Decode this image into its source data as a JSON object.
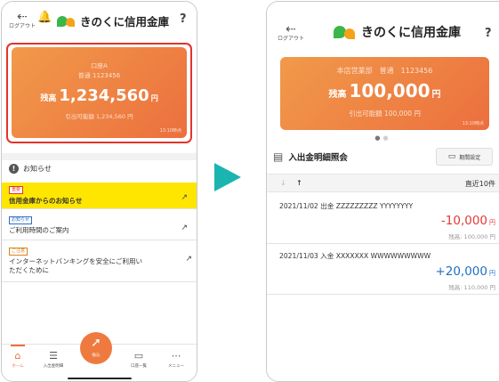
{
  "colors": {
    "accent_orange": "#ec6f3e",
    "highlight_red": "#e5332a",
    "notice_yellow": "#ffe600",
    "debit_red": "#e53935",
    "credit_blue": "#1f6fc4",
    "arrow_teal": "#1ab5b0"
  },
  "app": {
    "brand_name": "きのくに信用金庫",
    "logout_label": "ログアウト",
    "help_icon": "?"
  },
  "left": {
    "card": {
      "account_name": "口座A",
      "account_number": "普通 1123456",
      "balance_label": "残高",
      "balance": "1,234,560",
      "currency": "円",
      "available": "引出可能額 1,234,560 円",
      "time": "13:10時点"
    },
    "notices": {
      "title": "お知らせ",
      "items": [
        {
          "tag": "重要",
          "text": "信用金庫からのお知らせ"
        },
        {
          "tag": "お知らせ",
          "text": "ご利用時間のご案内"
        },
        {
          "tag": "ご注意",
          "text_line1": "インターネットバンキングを安全にご利用い",
          "text_line2": "ただくために"
        }
      ]
    },
    "nav": {
      "home": "ホーム",
      "history": "入出金明細",
      "transfer": "振込",
      "accounts": "口座一覧",
      "menu": "メニュー"
    }
  },
  "right": {
    "card": {
      "branch_line": "本店営業部　普通　1123456",
      "balance_label": "残高",
      "balance": "100,000",
      "currency": "円",
      "available": "引出可能額 100,000 円",
      "time": "13:10時点"
    },
    "statement": {
      "title": "入出金明細照会",
      "period_button": "期間設定",
      "sort_label": "直近10件",
      "transactions": [
        {
          "description": "2021/11/02 出金 ZZZZZZZZZ YYYYYYYY",
          "amount": "-10,000",
          "currency": "円",
          "balance": "残高: 100,000 円"
        },
        {
          "description": "2021/11/03 入金 XXXXXXX WWWWWWWWW",
          "amount": "+20,000",
          "currency": "円",
          "balance": "残高: 110,000 円"
        }
      ]
    }
  }
}
